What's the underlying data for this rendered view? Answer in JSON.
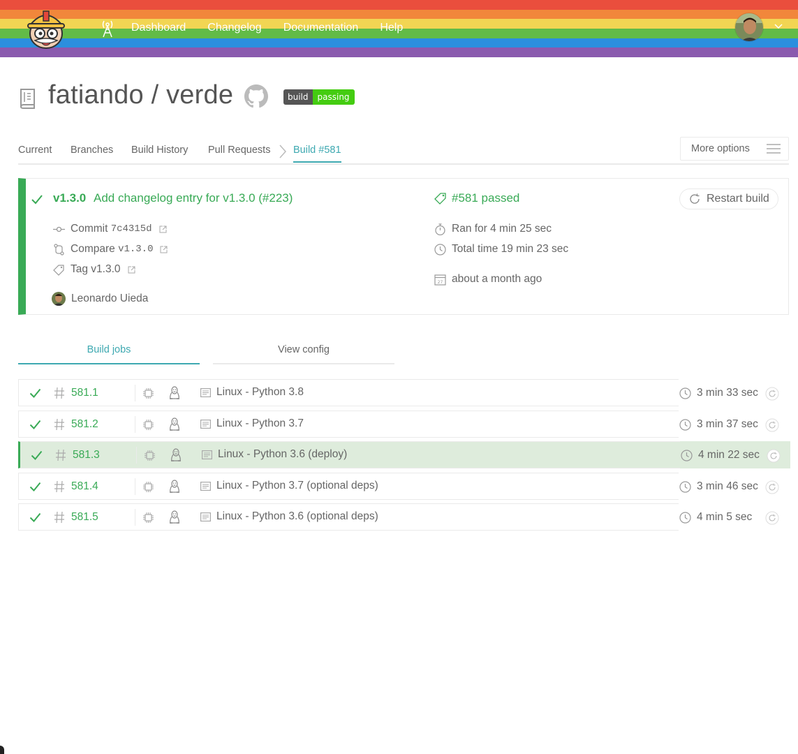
{
  "colors": {
    "stripes": [
      "#ea4e3d",
      "#f1873b",
      "#f2d553",
      "#62bb47",
      "#2b8fde",
      "#8a5aae"
    ],
    "accent_teal": "#3ea9b1",
    "passed_green": "#39aa56",
    "row_highlight": "#deecdc"
  },
  "topbar": {
    "logo_icon": "travis-mascot-icon",
    "nav": [
      "Dashboard",
      "Changelog",
      "Documentation",
      "Help"
    ],
    "radio_icon": "broadcast-tower-icon",
    "avatar_icon": "user-avatar"
  },
  "repo": {
    "title": "fatiando / verde",
    "icon": "repo-icon",
    "github_icon": "github-icon",
    "badge": {
      "left": "build",
      "right": "passing"
    }
  },
  "tabs": {
    "items": [
      "Current",
      "Branches",
      "Build History",
      "Pull Requests",
      "Build #581"
    ],
    "active": "Build #581",
    "more_options": "More options"
  },
  "build": {
    "version": "v1.3.0",
    "message": "Add changelog entry for v1.3.0 (#223)",
    "commit_label": "Commit",
    "commit_sha": "7c4315d",
    "compare_label": "Compare",
    "compare_ref": "v1.3.0",
    "tag_label": "Tag v1.3.0",
    "author": "Leonardo Uieda",
    "status": "#581 passed",
    "ran_for": "Ran for 4 min 25 sec",
    "total_time": "Total time 19 min 23 sec",
    "when": "about a month ago",
    "restart_label": "Restart build"
  },
  "subtabs": [
    "Build jobs",
    "View config"
  ],
  "jobs": [
    {
      "number": "581.1",
      "name": "Linux - Python 3.8",
      "duration": "3 min 33 sec",
      "highlighted": false
    },
    {
      "number": "581.2",
      "name": "Linux - Python 3.7",
      "duration": "3 min 37 sec",
      "highlighted": false
    },
    {
      "number": "581.3",
      "name": "Linux - Python 3.6 (deploy)",
      "duration": "4 min 22 sec",
      "highlighted": true
    },
    {
      "number": "581.4",
      "name": "Linux - Python 3.7 (optional deps)",
      "duration": "3 min 46 sec",
      "highlighted": false
    },
    {
      "number": "581.5",
      "name": "Linux - Python 3.6 (optional deps)",
      "duration": "4 min 5 sec",
      "highlighted": false
    }
  ]
}
